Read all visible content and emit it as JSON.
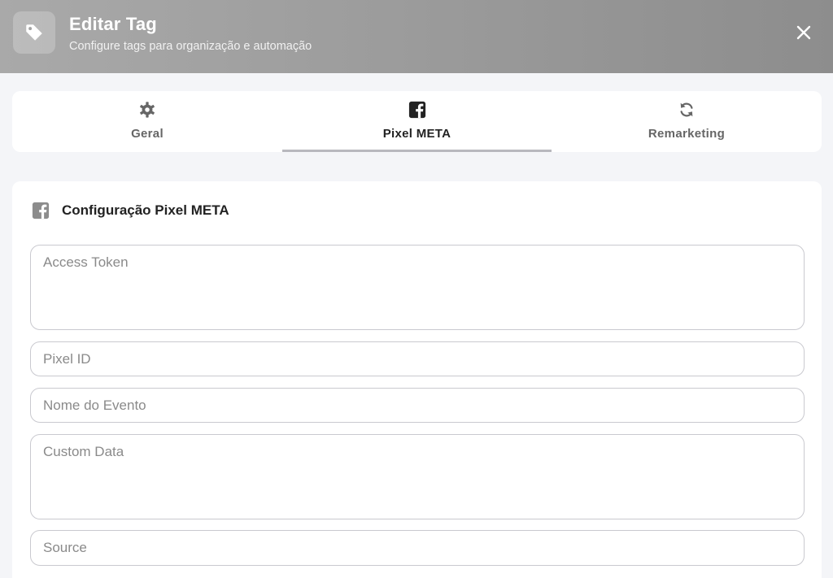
{
  "header": {
    "title": "Editar Tag",
    "subtitle": "Configure tags para organização e automação",
    "icon": "tag-icon",
    "close_icon": "close-icon"
  },
  "tabs": [
    {
      "label": "Geral",
      "icon": "gear-icon",
      "active": false
    },
    {
      "label": "Pixel META",
      "icon": "facebook-icon",
      "active": true
    },
    {
      "label": "Remarketing",
      "icon": "refresh-icon",
      "active": false
    }
  ],
  "section": {
    "title": "Configuração Pixel META",
    "icon": "facebook-icon"
  },
  "fields": {
    "access_token": {
      "placeholder": "Access Token",
      "value": ""
    },
    "pixel_id": {
      "placeholder": "Pixel ID",
      "value": ""
    },
    "event_name": {
      "placeholder": "Nome do Evento",
      "value": ""
    },
    "custom_data": {
      "placeholder": "Custom Data",
      "value": ""
    },
    "source": {
      "placeholder": "Source",
      "value": ""
    }
  },
  "colors": {
    "header_start": "#a9a9a9",
    "header_end": "#8d8d8d",
    "page_background": "#f4f5f8",
    "active_tab_indicator": "#b8b8be"
  }
}
